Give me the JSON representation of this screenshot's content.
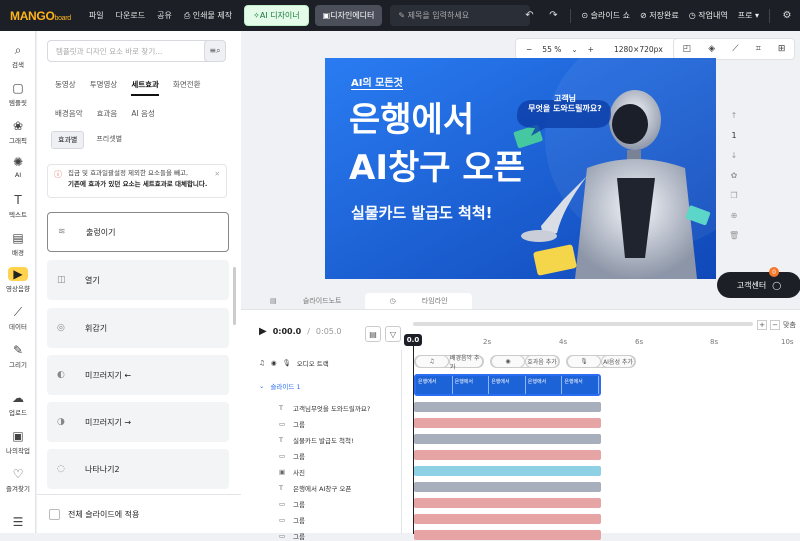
{
  "topbar": {
    "logo": "MANGO",
    "logo_sub": "board",
    "menus": [
      "파일",
      "다운로드",
      "공유",
      "인쇄물 제작"
    ],
    "ai_designer": "AI 디자이너",
    "design_editor": "디자인에디터",
    "title_placeholder": "제목을 입력하세요",
    "slide_show": "슬라이드 쇼",
    "save_status": "저장완료",
    "work_history": "작업내역",
    "plan": "프로"
  },
  "leftnav": [
    {
      "label": "검색",
      "icon": "search-icon"
    },
    {
      "label": "템플릿",
      "icon": "template-icon"
    },
    {
      "label": "그래픽",
      "icon": "graphic-icon"
    },
    {
      "label": "AI",
      "icon": "ai-icon"
    },
    {
      "label": "텍스트",
      "icon": "text-icon"
    },
    {
      "label": "배경",
      "icon": "background-icon"
    },
    {
      "label": "영상음향",
      "icon": "video-audio-icon"
    },
    {
      "label": "데이터",
      "icon": "data-icon"
    },
    {
      "label": "그리기",
      "icon": "draw-icon"
    },
    {
      "label": "업로드",
      "icon": "upload-icon"
    },
    {
      "label": "나의작업",
      "icon": "my-work-icon"
    },
    {
      "label": "즐겨찾기",
      "icon": "favorites-icon"
    }
  ],
  "panel": {
    "search_placeholder": "템플릿과 디자인 요소 바로 찾기...",
    "tabs1": [
      "동영상",
      "투명영상",
      "세트효과",
      "화면전환"
    ],
    "tabs2": [
      "배경음악",
      "효과음",
      "AI 음성"
    ],
    "tabs3": [
      "효과별",
      "프리셋별"
    ],
    "notice_line1": "집금 및 효과일괄설정 제외한 요소들을 빼고,",
    "notice_line2": "기존에 효과가 있던 요소는 세트효과로 대체합니다.",
    "effects": [
      "출렁이기",
      "열기",
      "휘감기",
      "미끄러지기 ←",
      "미끄러지기 →",
      "나타나기2"
    ],
    "apply_all": "전체 슬라이드에 적용"
  },
  "canvas": {
    "zoom": "55 %",
    "size": "1280×720px",
    "page_number": "1",
    "help_center": "고객센터",
    "help_badge": "0"
  },
  "slide": {
    "tag": "AI의 모든것",
    "line1": "은행에서",
    "line2": "AI창구 오픈",
    "line3": "실물카드 발급도 척척!",
    "bubble_line1": "고객님",
    "bubble_line2": "무엇을 도와드릴까요?"
  },
  "timeline": {
    "tabs": [
      "슬라이드노트",
      "타임라인"
    ],
    "current_time": "0:00.0",
    "divider": "/",
    "duration": "0:05.0",
    "playhead": "0.0",
    "ticks": [
      "2s",
      "4s",
      "6s",
      "8s",
      "10s"
    ],
    "zoom_label": "맞춤",
    "audio_track": "오디오 트랙",
    "add_buttons": [
      "배경음악 추가",
      "효과음 추가",
      "AI음성 추가"
    ],
    "slide_label": "슬라이드 1",
    "layers": [
      {
        "icon": "T",
        "label": "고객님무엇을 도와드릴까요?"
      },
      {
        "icon": "▭",
        "label": "그룹"
      },
      {
        "icon": "T",
        "label": "실물카드 발급도 척척!"
      },
      {
        "icon": "▭",
        "label": "그룹"
      },
      {
        "icon": "▣",
        "label": "사진"
      },
      {
        "icon": "T",
        "label": "은행에서 AI창구 오픈"
      },
      {
        "icon": "▭",
        "label": "그룹"
      },
      {
        "icon": "▭",
        "label": "그룹"
      },
      {
        "icon": "▭",
        "label": "그룹"
      }
    ],
    "clip_colors": [
      "#a7afbd",
      "#e6a4a4",
      "#a7afbd",
      "#e6a4a4",
      "#8ed0e4",
      "#a7afbd",
      "#e6a4a4",
      "#e6a4a4",
      "#e6a4a4"
    ]
  }
}
